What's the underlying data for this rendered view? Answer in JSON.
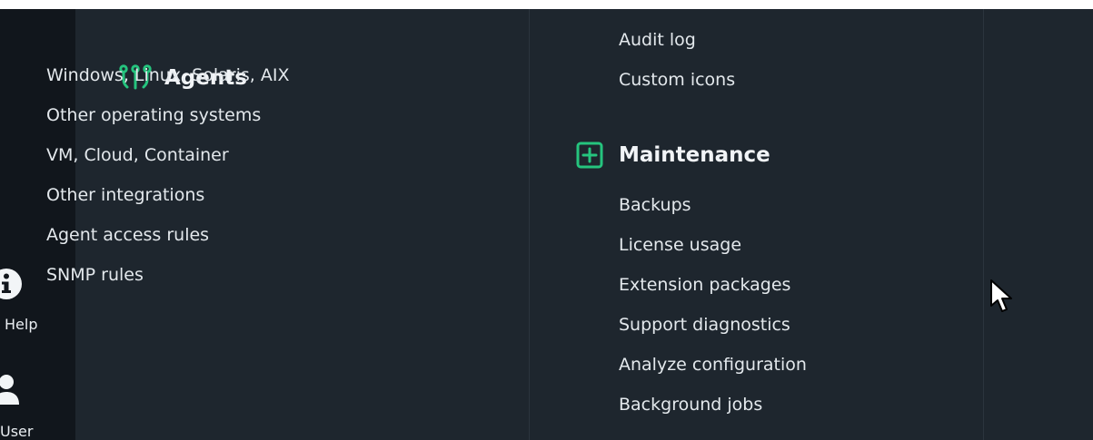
{
  "sidebar": {
    "help_label": "Help",
    "user_label": "User",
    "help_icon": "info-circle-icon",
    "user_icon": "user-icon"
  },
  "menu": {
    "top_items": [
      "Audit log",
      "Custom icons"
    ],
    "agents": {
      "title": "Agents",
      "icon": "agents-icon",
      "items": [
        "Windows, Linux, Solaris, AIX",
        "Other operating systems",
        "VM, Cloud, Container",
        "Other integrations",
        "Agent access rules",
        "SNMP rules"
      ]
    },
    "maintenance": {
      "title": "Maintenance",
      "icon": "plus-square-icon",
      "items": [
        "Backups",
        "License usage",
        "Extension packages",
        "Support diagnostics",
        "Analyze configuration",
        "Background jobs"
      ]
    }
  },
  "colors": {
    "accent": "#25c47e",
    "panel_bg": "#1e262e",
    "rail_bg": "#11161c",
    "text": "#e3e8ec"
  }
}
